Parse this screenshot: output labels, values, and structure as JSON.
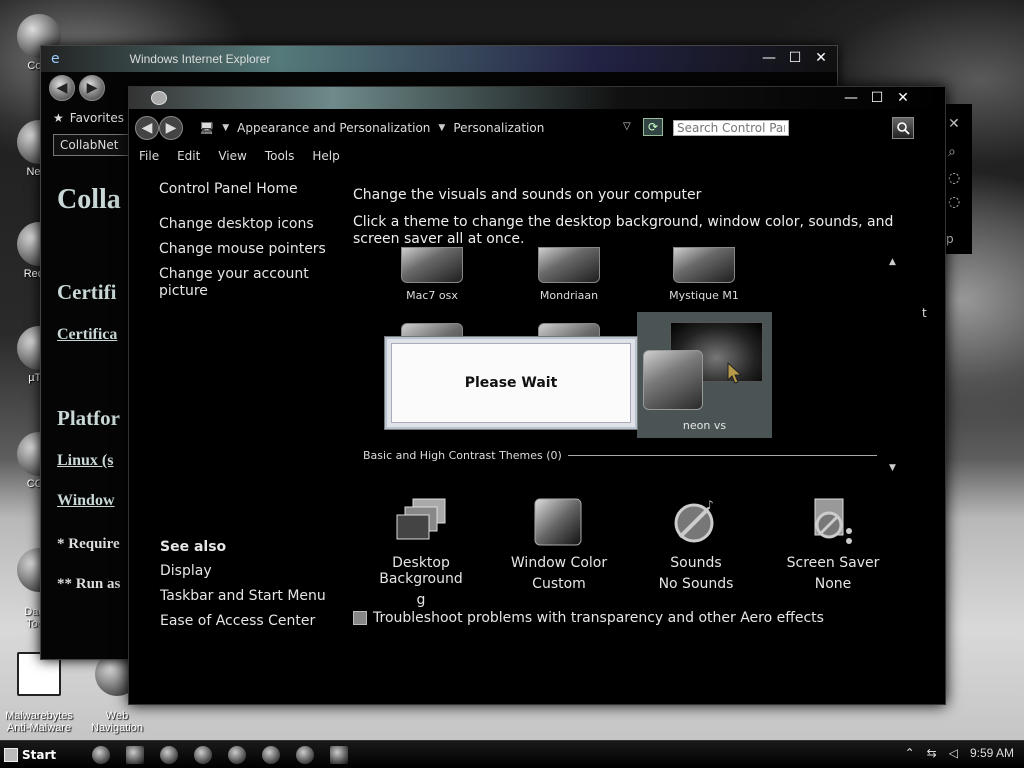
{
  "desktop": {
    "icons": [
      {
        "label": "Com",
        "name": "computer"
      },
      {
        "label": "Netw",
        "name": "network"
      },
      {
        "label": "Recyc",
        "name": "recycle-bin"
      },
      {
        "label": "µTor",
        "name": "utorrent"
      },
      {
        "label": "CCle",
        "name": "ccleaner"
      },
      {
        "label": "Daem\nTools",
        "name": "daemon-tools"
      },
      {
        "label": "Malwarebytes\nAnti-Malware",
        "name": "malwarebytes"
      },
      {
        "label": "Web\nNavigation",
        "name": "web-navigation"
      }
    ]
  },
  "ie_window": {
    "title": "Windows Internet Explorer",
    "favorites_label": "Favorites",
    "tab_label": "CollabNet",
    "content": {
      "title": "Colla",
      "heading1": "Certifi",
      "link1": "Certifica",
      "heading2": "Platfor",
      "link2": "Linux (s",
      "link3": "Window",
      "note1": "* Require",
      "note2": "** Run as"
    }
  },
  "control_panel": {
    "breadcrumbs": [
      "Appearance and Personalization",
      "Personalization"
    ],
    "search_placeholder": "Search Control Panel",
    "menu": [
      "File",
      "Edit",
      "View",
      "Tools",
      "Help"
    ],
    "sidebar_links": [
      "Control Panel Home",
      "Change desktop icons",
      "Change mouse pointers",
      "Change your account picture"
    ],
    "main_title": "Change the visuals and sounds on your computer",
    "main_description": "Click a theme to change the desktop background, window color, sounds, and screen saver all at once.",
    "themes": [
      {
        "label": "Mac7 osx"
      },
      {
        "label": "Mondriaan"
      },
      {
        "label": "Mystique M1"
      },
      {
        "label": "neon vs"
      }
    ],
    "dialog_text": "Please Wait",
    "basic_section_label": "Basic and High Contrast Themes (0)",
    "settings": [
      {
        "line1": "Desktop Background",
        "line2": "g"
      },
      {
        "line1": "Window Color",
        "line2": "Custom"
      },
      {
        "line1": "Sounds",
        "line2": "No Sounds"
      },
      {
        "line1": "Screen Saver",
        "line2": "None"
      }
    ],
    "transparency_link": "Troubleshoot problems with transparency and other Aero effects",
    "see_also": {
      "heading": "See also",
      "links": [
        "Display",
        "Taskbar and Start Menu",
        "Ease of Access Center"
      ]
    },
    "right_edge_text": [
      "p",
      "t"
    ]
  },
  "taskbar": {
    "start_label": "Start",
    "clock": "9:59 AM"
  }
}
